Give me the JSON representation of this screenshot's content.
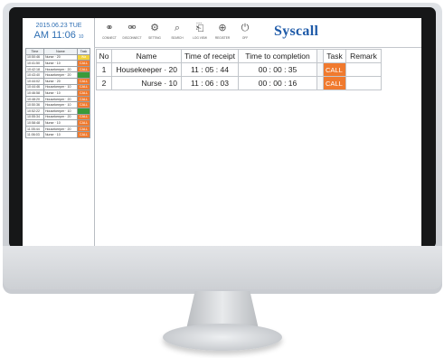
{
  "left_panel": {
    "date": "2015.06.23 TUE",
    "time": "AM 11:06",
    "seconds": "10",
    "headers": [
      "Time",
      "Name",
      "Task"
    ],
    "rows": [
      {
        "time": "10:50:46",
        "name": "Nurse · 20",
        "task": "Wa",
        "color": "#f4d23a"
      },
      {
        "time": "10:41:50",
        "name": "Nurse · 10",
        "task": "CALL",
        "color": "#f07a2e"
      },
      {
        "time": "10:42:18",
        "name": "Housekeeper · 20",
        "task": "CALL",
        "color": "#f07a2e"
      },
      {
        "time": "10:43:40",
        "name": "Housekeeper · 20",
        "task": "",
        "color": "#3a9a3a"
      },
      {
        "time": "10:44:02",
        "name": "Nurse · 20",
        "task": "CALL",
        "color": "#f07a2e"
      },
      {
        "time": "10:44:46",
        "name": "Housekeeper · 10",
        "task": "CALL",
        "color": "#f07a2e"
      },
      {
        "time": "10:46:58",
        "name": "Nurse · 10",
        "task": "CALL",
        "color": "#f07a2e"
      },
      {
        "time": "10:48:20",
        "name": "Housekeeper · 20",
        "task": "CALL",
        "color": "#f07a2e"
      },
      {
        "time": "10:50:36",
        "name": "Housekeeper · 10",
        "task": "CALL",
        "color": "#f07a2e"
      },
      {
        "time": "10:52:22",
        "name": "Housekeeper · 10",
        "task": "",
        "color": "#3a9a3a"
      },
      {
        "time": "10:55:34",
        "name": "Housekeeper · 20",
        "task": "CALL",
        "color": "#f07a2e"
      },
      {
        "time": "10:58:48",
        "name": "Nurse · 10",
        "task": "CALL",
        "color": "#f07a2e"
      },
      {
        "time": "11:05:44",
        "name": "Housekeeper · 20",
        "task": "CALL",
        "color": "#f07a2e"
      },
      {
        "time": "11:06:03",
        "name": "Nurse · 10",
        "task": "CALL",
        "color": "#f07a2e"
      }
    ]
  },
  "toolbar": {
    "items": [
      {
        "label": "CONNECT",
        "icon": "link-icon",
        "glyph": "⚭"
      },
      {
        "label": "DISCONNECT",
        "icon": "unlink-icon",
        "glyph": "⚮"
      },
      {
        "label": "SETTING",
        "icon": "gear-icon",
        "glyph": "⚙"
      },
      {
        "label": "SEARCH",
        "icon": "search-icon",
        "glyph": "⌕"
      },
      {
        "label": "LOG VIEW",
        "icon": "document-icon",
        "glyph": "⎗"
      },
      {
        "label": "REGISTER",
        "icon": "plus-circle-icon",
        "glyph": "⊕"
      },
      {
        "label": "OFF",
        "icon": "power-icon",
        "glyph": "⏻"
      }
    ],
    "logo": "Syscall"
  },
  "main_table": {
    "headers": [
      "No",
      "Name",
      "Time of receipt",
      "Time to completion",
      "",
      "Task",
      "Remark"
    ],
    "rows": [
      {
        "no": "1",
        "name": "Housekeeper · 20",
        "receipt": "11 : 05 : 44",
        "completion": "00 : 00 : 35",
        "task": "CALL",
        "remark": ""
      },
      {
        "no": "2",
        "name": "Nurse · 10",
        "receipt": "11 : 06 : 03",
        "completion": "00 : 00 : 16",
        "task": "CALL",
        "remark": ""
      }
    ]
  },
  "colors": {
    "accent_blue": "#2f6fb3",
    "logo_blue": "#1e5aa8",
    "call_orange": "#f07a2e",
    "done_green": "#3a9a3a",
    "wait_yellow": "#f4d23a"
  }
}
